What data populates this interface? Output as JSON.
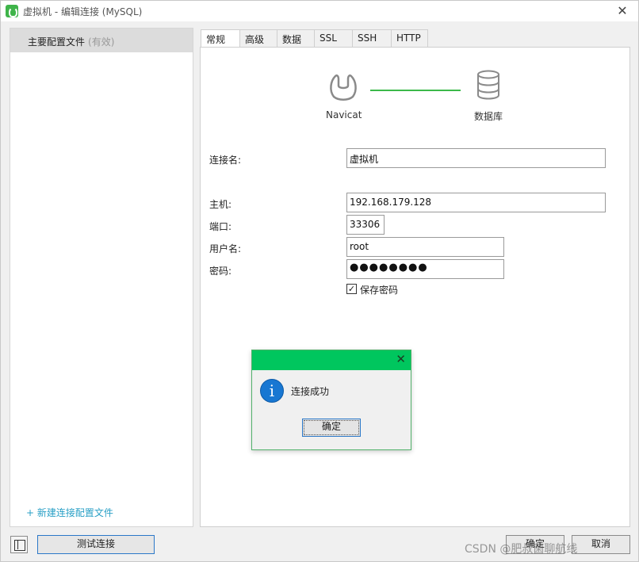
{
  "window": {
    "title": "虚拟机 - 编辑连接 (MySQL)",
    "close_glyph": "✕"
  },
  "sidebar": {
    "profile": {
      "name": "主要配置文件",
      "status": "(有效)"
    },
    "new_profile_link": "+ 新建连接配置文件"
  },
  "tabs": [
    "常规",
    "高级",
    "数据库",
    "SSL",
    "SSH",
    "HTTP"
  ],
  "active_tab": "常规",
  "flow": {
    "source_label": "Navicat",
    "target_label": "数据库",
    "link_color": "#3cb94a"
  },
  "form": {
    "connection_name": {
      "label": "连接名:",
      "value": "虚拟机"
    },
    "host": {
      "label": "主机:",
      "value": "192.168.179.128"
    },
    "port": {
      "label": "端口:",
      "value": "33306"
    },
    "username": {
      "label": "用户名:",
      "value": "root"
    },
    "password": {
      "label": "密码:",
      "value": "●●●●●●●●"
    },
    "save_password": {
      "label": "保存密码",
      "checked": true,
      "check_glyph": "✓"
    }
  },
  "buttons": {
    "test": "测试连接",
    "ok": "确定",
    "cancel": "取消"
  },
  "dialog": {
    "message": "连接成功",
    "ok": "确定",
    "icon_glyph": "i",
    "close_glyph": "✕"
  },
  "watermark": "CSDN @肥叔菌聊航线",
  "colors": {
    "dialog_bar": "#00c65e",
    "info_icon": "#1877d2",
    "accent_link": "#2aa0c6"
  }
}
